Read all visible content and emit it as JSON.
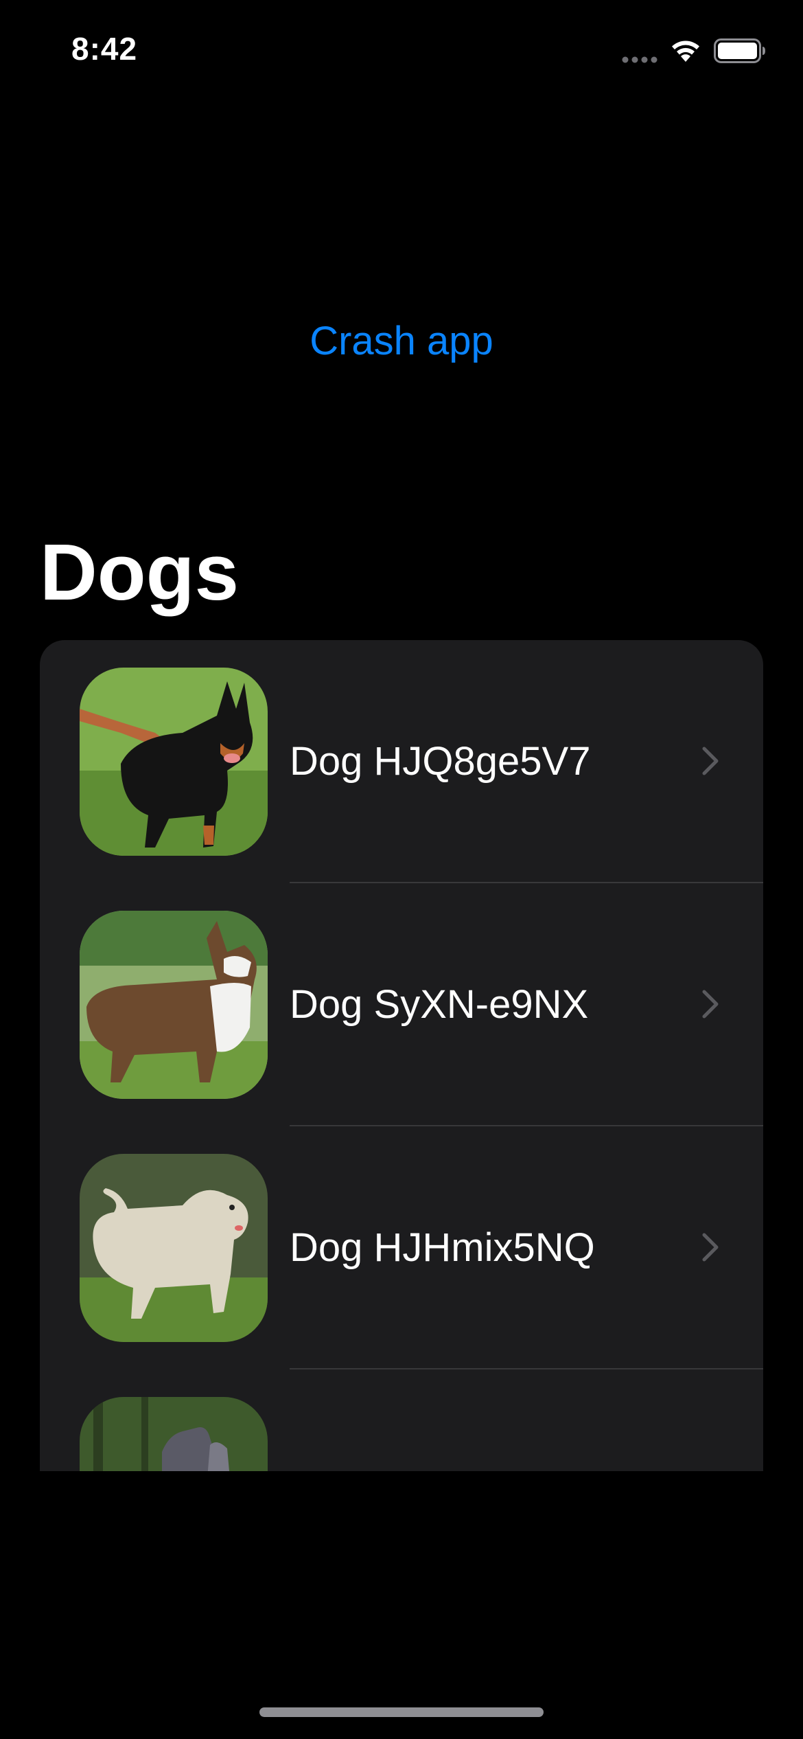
{
  "status_bar": {
    "time": "8:42",
    "icons": [
      "signal-dots-icon",
      "wifi-icon",
      "battery-icon"
    ]
  },
  "actions": {
    "crash_label": "Crash app",
    "crash_color": "#0a84ff"
  },
  "page": {
    "title": "Dogs"
  },
  "list": {
    "background": "#1c1c1e",
    "items": [
      {
        "label": "Dog HJQ8ge5V7",
        "photo": "black-and-tan-shepherd-on-leash"
      },
      {
        "label": "Dog SyXN-e9NX",
        "photo": "brindle-corgi-on-grass"
      },
      {
        "label": "Dog HJHmix5NQ",
        "photo": "cream-terrier-on-grass"
      },
      {
        "label": "",
        "photo": "grey-dogs-partial"
      }
    ]
  },
  "colors": {
    "background": "#000000",
    "separator": "#38383a",
    "chevron": "#5a5a5e"
  }
}
